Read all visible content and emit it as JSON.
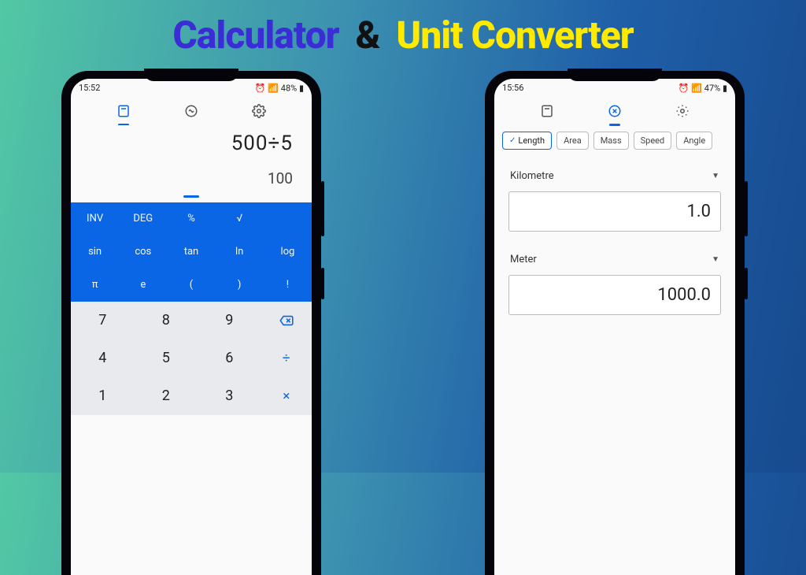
{
  "headline": {
    "word1": "Calculator",
    "amp": "&",
    "word2": "Unit Converter"
  },
  "phone_calc": {
    "status": {
      "time": "15:52",
      "extra": "⊕ ⊞",
      "battery": "48%"
    },
    "tabs": {
      "active": "calc"
    },
    "expression": "500÷5",
    "result": "100",
    "sci_keys": [
      "INV",
      "DEG",
      "%",
      "√",
      "",
      "sin",
      "cos",
      "tan",
      "ln",
      "log",
      "π",
      "e",
      "(",
      ")",
      "!"
    ],
    "keypad": {
      "rows": [
        [
          "7",
          "8",
          "9",
          "⌫"
        ],
        [
          "4",
          "5",
          "6",
          "÷"
        ],
        [
          "1",
          "2",
          "3",
          "×"
        ]
      ]
    }
  },
  "phone_conv": {
    "status": {
      "time": "15:56",
      "extra": "⊕ ⊞",
      "battery": "47%"
    },
    "tabs": {
      "active": "convert"
    },
    "chips": [
      "Length",
      "Area",
      "Mass",
      "Speed",
      "Angle"
    ],
    "from_unit": "Kilometre",
    "from_value": "1.0",
    "to_unit": "Meter",
    "to_value": "1000.0"
  }
}
